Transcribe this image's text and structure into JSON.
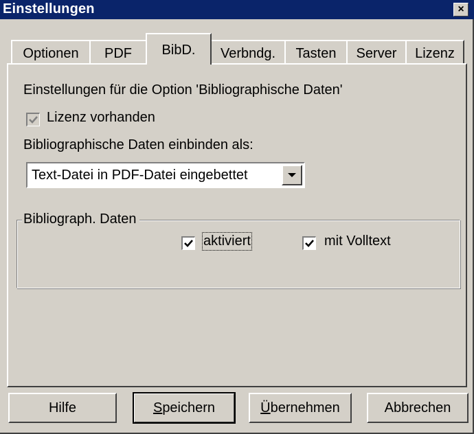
{
  "window": {
    "title": "Einstellungen",
    "close_glyph": "×"
  },
  "tabs": [
    {
      "label": "Optionen",
      "active": false
    },
    {
      "label": "PDF",
      "active": false
    },
    {
      "label": "BibD.",
      "active": true
    },
    {
      "label": "Verbndg.",
      "active": false
    },
    {
      "label": "Tasten",
      "active": false
    },
    {
      "label": "Server",
      "active": false
    },
    {
      "label": "Lizenz",
      "active": false
    }
  ],
  "bibd": {
    "heading": "Einstellungen für die Option 'Bibliographische Daten'",
    "license_checkbox": {
      "label": "Lizenz vorhanden",
      "checked": true,
      "enabled": false
    },
    "embed_label": "Bibliographische Daten einbinden als:",
    "embed_select": {
      "value": "Text-Datei in PDF-Datei eingebettet"
    },
    "group": {
      "title": "Bibliograph. Daten",
      "activated": {
        "label": "aktiviert",
        "checked": true
      },
      "fulltext": {
        "label": "mit Volltext",
        "checked": true
      }
    }
  },
  "buttons": {
    "help": "Hilfe",
    "save": {
      "accel": "S",
      "rest": "peichern"
    },
    "apply": {
      "accel": "Ü",
      "rest": "bernehmen"
    },
    "cancel": "Abbrechen"
  },
  "icons": {
    "close": "close-icon",
    "check": "checkmark-icon",
    "dropdown": "chevron-down-icon"
  },
  "colors": {
    "titlebar": "#0a246a",
    "face": "#d4d0c8",
    "shadow": "#808080",
    "dark_shadow": "#404040"
  }
}
